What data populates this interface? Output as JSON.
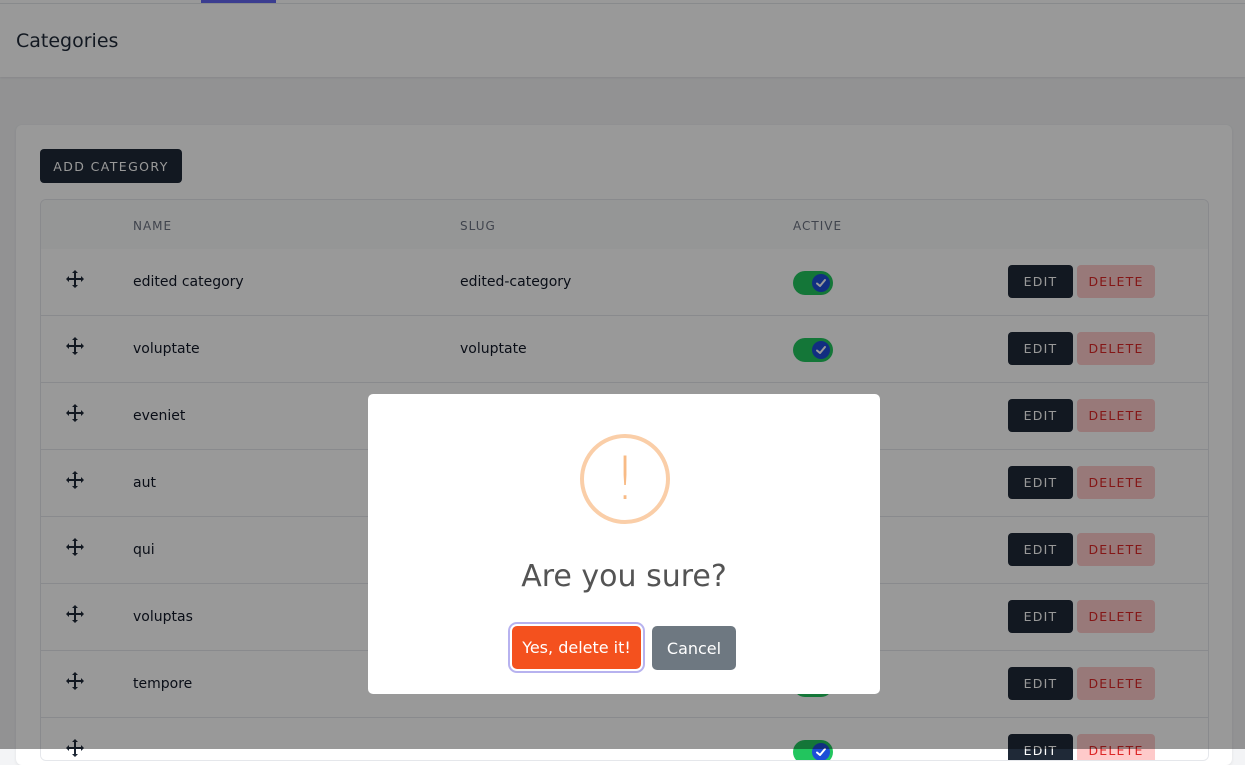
{
  "page": {
    "title": "Categories"
  },
  "toolbar": {
    "add_label": "ADD CATEGORY"
  },
  "table": {
    "headers": {
      "name": "NAME",
      "slug": "SLUG",
      "active": "ACTIVE"
    },
    "rows": [
      {
        "name": "edited category",
        "slug": "edited-category",
        "active": true,
        "edit": "EDIT",
        "delete": "DELETE"
      },
      {
        "name": "voluptate",
        "slug": "voluptate",
        "active": true,
        "edit": "EDIT",
        "delete": "DELETE"
      },
      {
        "name": "eveniet",
        "slug": "",
        "active": true,
        "edit": "EDIT",
        "delete": "DELETE"
      },
      {
        "name": "aut",
        "slug": "",
        "active": true,
        "edit": "EDIT",
        "delete": "DELETE"
      },
      {
        "name": "qui",
        "slug": "",
        "active": true,
        "edit": "EDIT",
        "delete": "DELETE"
      },
      {
        "name": "voluptas",
        "slug": "",
        "active": true,
        "edit": "EDIT",
        "delete": "DELETE"
      },
      {
        "name": "tempore",
        "slug": "",
        "active": true,
        "edit": "EDIT",
        "delete": "DELETE"
      },
      {
        "name": "",
        "slug": "",
        "active": true,
        "edit": "EDIT",
        "delete": "DELETE"
      }
    ]
  },
  "dialog": {
    "icon": "!",
    "title": "Are you sure?",
    "confirm_label": "Yes, delete it!",
    "cancel_label": "Cancel"
  },
  "colors": {
    "primary_dark": "#1f2937",
    "accent": "#6366f1",
    "toggle_on": "#22c55e",
    "danger": "#f4511e"
  }
}
